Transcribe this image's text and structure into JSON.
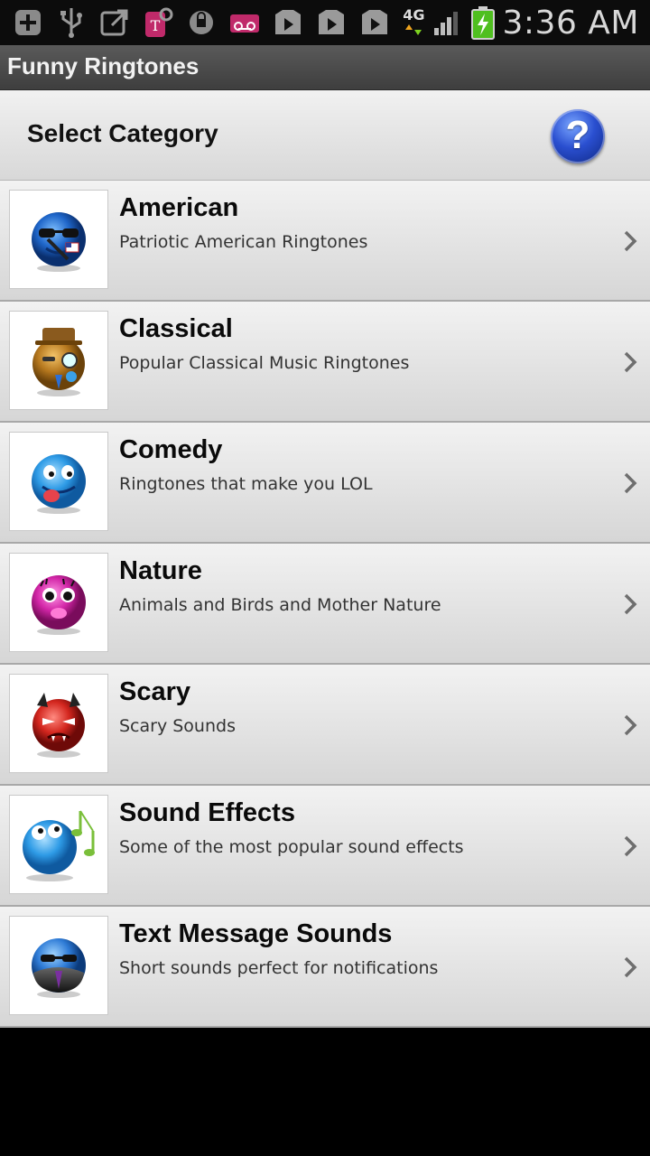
{
  "status_bar": {
    "network": "4G",
    "time": "3:36 AM",
    "icons": [
      "add-icon",
      "usb-icon",
      "external-link-icon",
      "tmobile-icon",
      "security-icon",
      "voicemail-icon",
      "play-store-icon",
      "play-store-icon",
      "play-store-icon"
    ]
  },
  "app": {
    "title": "Funny Ringtones"
  },
  "header": {
    "title": "Select Category",
    "help_icon": "?"
  },
  "categories": [
    {
      "title": "American",
      "subtitle": "Patriotic American Ringtones",
      "icon": "american-emoticon",
      "color": "#2c6fd6"
    },
    {
      "title": "Classical",
      "subtitle": "Popular Classical Music Ringtones",
      "icon": "classical-emoticon",
      "color": "#c08a2a"
    },
    {
      "title": "Comedy",
      "subtitle": "Ringtones that make you LOL",
      "icon": "comedy-emoticon",
      "color": "#3aa0e8"
    },
    {
      "title": "Nature",
      "subtitle": "Animals and Birds and Mother Nature",
      "icon": "nature-emoticon",
      "color": "#d326a8"
    },
    {
      "title": "Scary",
      "subtitle": "Scary Sounds",
      "icon": "scary-emoticon",
      "color": "#d3261e"
    },
    {
      "title": "Sound Effects",
      "subtitle": "Some of the most popular sound effects",
      "icon": "sound-effects-emoticon",
      "color": "#3aa0e8"
    },
    {
      "title": "Text Message Sounds",
      "subtitle": "Short sounds perfect for notifications",
      "icon": "text-message-emoticon",
      "color": "#2a2a2a"
    }
  ]
}
